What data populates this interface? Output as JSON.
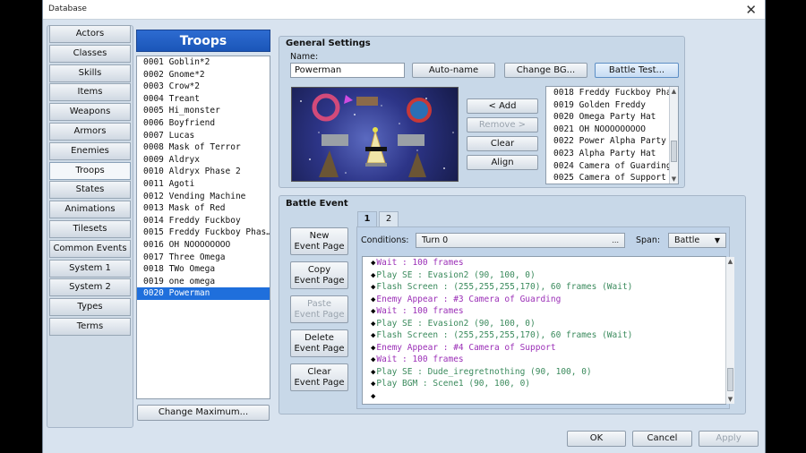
{
  "window": {
    "title": "Database",
    "close_glyph": "✕"
  },
  "nav": {
    "items": [
      "Actors",
      "Classes",
      "Skills",
      "Items",
      "Weapons",
      "Armors",
      "Enemies",
      "Troops",
      "States",
      "Animations",
      "Tilesets",
      "Common Events",
      "System 1",
      "System 2",
      "Types",
      "Terms"
    ],
    "active": "Troops"
  },
  "troops": {
    "header": "Troops",
    "items": [
      "0001 Goblin*2",
      "0002 Gnome*2",
      "0003 Crow*2",
      "0004 Treant",
      "0005 Hi_monster",
      "0006 Boyfriend",
      "0007 Lucas",
      "0008 Mask of Terror",
      "0009 Aldryx",
      "0010 Aldryx Phase 2",
      "0011 Agoti",
      "0012 Vending Machine",
      "0013 Mask of Red",
      "0014 Freddy Fuckboy",
      "0015 Freddy Fuckboy Phas…",
      "0016 OH NOOOOOOOO",
      "0017 Three Omega",
      "0018 TWo Omega",
      "0019 one omega",
      "0020 Powerman"
    ],
    "selected_index": 19,
    "change_max_label": "Change Maximum..."
  },
  "general": {
    "title": "General Settings",
    "name_label": "Name:",
    "name_value": "Powerman",
    "autoname_label": "Auto-name",
    "change_bg_label": "Change BG...",
    "battle_test_label": "Battle Test...",
    "add_label": "< Add",
    "remove_label": "Remove >",
    "clear_label": "Clear",
    "align_label": "Align",
    "members": [
      "0018 Freddy Fuckboy Phas…",
      "0019 Golden Freddy",
      "0020 Omega Party Hat",
      "0021 OH NOOOOOOOOO",
      "0022 Power Alpha Party Hat",
      "0023 Alpha Party Hat",
      "0024 Camera of Guarding",
      "0025 Camera of Support"
    ]
  },
  "battle_event": {
    "title": "Battle Event",
    "tabs": [
      "1",
      "2"
    ],
    "active_tab": "1",
    "new_page": "New\nEvent Page",
    "copy_page": "Copy\nEvent Page",
    "paste_page": "Paste\nEvent Page",
    "delete_page": "Delete\nEvent Page",
    "clear_page": "Clear\nEvent Page",
    "conditions_label": "Conditions:",
    "conditions_value": "Turn 0",
    "conditions_more": "...",
    "span_label": "Span:",
    "span_value": "Battle",
    "commands": [
      {
        "color": "purple",
        "text": "Wait : 100 frames"
      },
      {
        "color": "green",
        "text": "Play SE : Evasion2 (90, 100, 0)"
      },
      {
        "color": "green",
        "text": "Flash Screen : (255,255,255,170), 60 frames (Wait)"
      },
      {
        "color": "purple",
        "text": "Enemy Appear : #3 Camera of Guarding"
      },
      {
        "color": "purple",
        "text": "Wait : 100 frames"
      },
      {
        "color": "green",
        "text": "Play SE : Evasion2 (90, 100, 0)"
      },
      {
        "color": "green",
        "text": "Flash Screen : (255,255,255,170), 60 frames (Wait)"
      },
      {
        "color": "purple",
        "text": "Enemy Appear : #4 Camera of Support"
      },
      {
        "color": "purple",
        "text": "Wait : 100 frames"
      },
      {
        "color": "green",
        "text": "Play SE : Dude_iregretnothing (90, 100, 0)"
      },
      {
        "color": "green",
        "text": "Play BGM : Scene1 (90, 100, 0)"
      },
      {
        "color": "black",
        "text": ""
      }
    ]
  },
  "footer": {
    "ok": "OK",
    "cancel": "Cancel",
    "apply": "Apply"
  },
  "colors": {
    "accent": "#1f6fdc",
    "event_purple": "#9b2fb7",
    "event_green": "#3a8a5c"
  }
}
